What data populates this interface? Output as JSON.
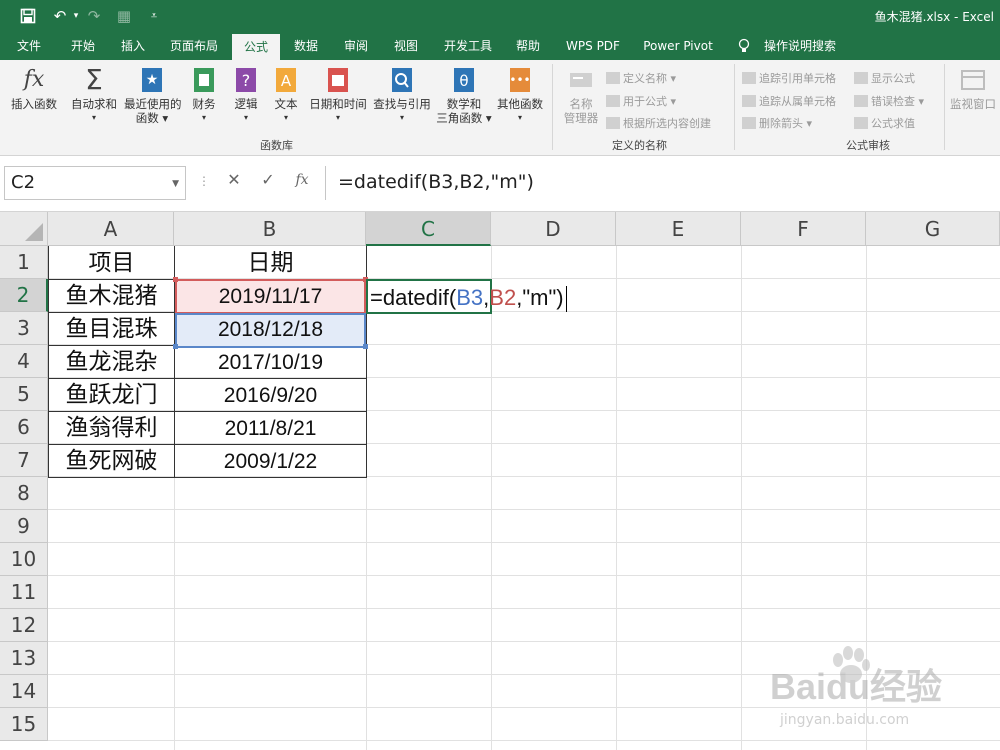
{
  "title": "鱼木混猪.xlsx  -  Excel",
  "tabs": [
    "文件",
    "开始",
    "插入",
    "页面布局",
    "公式",
    "数据",
    "审阅",
    "视图",
    "开发工具",
    "帮助",
    "WPS PDF",
    "Power Pivot",
    "操作说明搜索"
  ],
  "active_tab": "公式",
  "ribbon": {
    "insert_function": "插入函数",
    "autosum": "自动求和",
    "recent_1": "最近使用的",
    "recent_2": "函数",
    "financial": "财务",
    "logical": "逻辑",
    "text": "文本",
    "datetime": "日期和时间",
    "lookup": "查找与引用",
    "math_1": "数学和",
    "math_2": "三角函数",
    "more": "其他函数",
    "group_library": "函数库",
    "name_mgr_1": "名称",
    "name_mgr_2": "管理器",
    "define_name": "定义名称",
    "use_in_formula": "用于公式",
    "create_from_sel": "根据所选内容创建",
    "group_defined": "定义的名称",
    "trace_precedents": "追踪引用单元格",
    "trace_dependents": "追踪从属单元格",
    "remove_arrows": "删除箭头",
    "show_formulas": "显示公式",
    "error_checking": "错误检查",
    "evaluate": "公式求值",
    "group_audit": "公式审核",
    "watch": "监视窗口"
  },
  "namebox": "C2",
  "formula": "=datedif(B3,B2,\"m\")",
  "columns": [
    "A",
    "B",
    "C",
    "D",
    "E",
    "F",
    "G"
  ],
  "rows": [
    "1",
    "2",
    "3",
    "4",
    "5",
    "6",
    "7",
    "8",
    "9",
    "10",
    "11",
    "12",
    "13",
    "14",
    "15"
  ],
  "cells": {
    "A1": "项目",
    "B1": "日期",
    "A2": "鱼木混猪",
    "B2": "2019/11/17",
    "A3": "鱼目混珠",
    "B3": "2018/12/18",
    "A4": "鱼龙混杂",
    "B4": "2017/10/19",
    "A5": "鱼跃龙门",
    "B5": "2016/9/20",
    "A6": "渔翁得利",
    "B6": "2011/8/21",
    "A7": "鱼死网破",
    "B7": "2009/1/22"
  },
  "editing": {
    "p1": "=datedif(",
    "ref1": "B3",
    "comma1": ",",
    "ref2": "B2",
    "p2": ",\"m\")"
  },
  "colors": {
    "excel_green": "#217346",
    "ref_blue": "#4472c4",
    "ref_red": "#c0504d"
  },
  "watermark": {
    "brand": "Baidu经验",
    "sub": "jingyan.baidu.com"
  }
}
